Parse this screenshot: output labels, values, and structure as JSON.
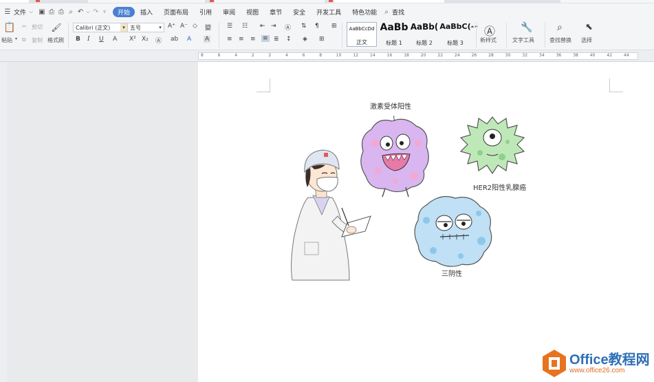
{
  "menu": {
    "file": "文件",
    "tabs": [
      "开始",
      "插入",
      "页面布局",
      "引用",
      "审阅",
      "视图",
      "章节",
      "安全",
      "开发工具",
      "特色功能"
    ],
    "search": "查找"
  },
  "ribbon": {
    "paste": "粘贴",
    "cut": "剪切",
    "copy": "复制",
    "format_painter": "格式刷",
    "font_name": "Calibri (正文)",
    "font_size": "五号",
    "styles": [
      {
        "sample": "AaBbCcDd",
        "label": "正文"
      },
      {
        "sample": "AaBb",
        "label": "标题 1"
      },
      {
        "sample": "AaBb(",
        "label": "标题 2"
      },
      {
        "sample": "AaBbC(",
        "label": "标题 3"
      }
    ],
    "new_style": "新样式",
    "text_tools": "文字工具",
    "find_replace": "查找替换",
    "select": "选择"
  },
  "ruler": {
    "ticks": [
      "8",
      "6",
      "4",
      "2",
      "2",
      "4",
      "6",
      "8",
      "10",
      "12",
      "14",
      "16",
      "18",
      "20",
      "22",
      "24",
      "26",
      "28",
      "30",
      "32",
      "34",
      "36",
      "38",
      "40",
      "42",
      "44"
    ]
  },
  "document": {
    "label_hormone": "激素受体阳性",
    "label_her2": "HER2阳性乳腺癌",
    "label_triple": "三阴性"
  },
  "watermark": {
    "title": "Office教程网",
    "url": "www.office26.com"
  },
  "colors": {
    "accent": "#4a7fd3",
    "germ_purple": "#d9b6f0",
    "germ_green": "#bfe8b8",
    "germ_blue": "#bfe0f5",
    "watermark_orange": "#e06b22"
  }
}
